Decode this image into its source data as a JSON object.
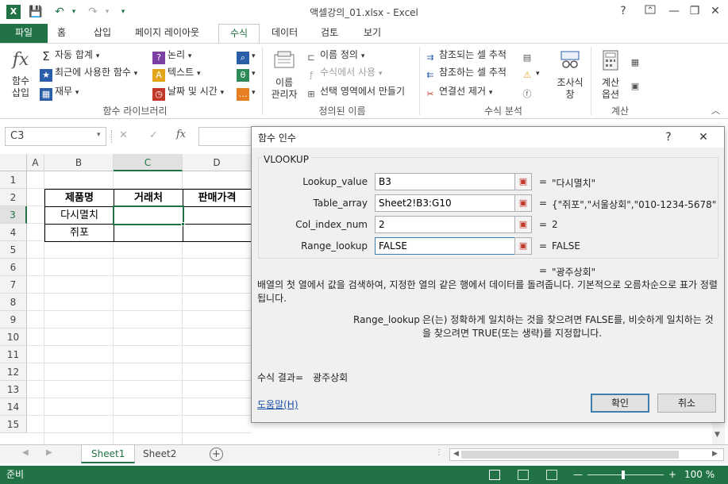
{
  "window": {
    "title": "액셀강의_01.xlsx - Excel",
    "help": "?",
    "minimize": "—",
    "restore": "❐",
    "close": "✕"
  },
  "qat": {
    "logo": "X",
    "save_icon": "💾",
    "undo_icon": "↶",
    "redo_icon": "↷",
    "more_icon": "▾"
  },
  "tabs": [
    {
      "label": "파일"
    },
    {
      "label": "홈"
    },
    {
      "label": "삽입"
    },
    {
      "label": "페이지 레이아웃"
    },
    {
      "label": "수식"
    },
    {
      "label": "데이터"
    },
    {
      "label": "검토"
    },
    {
      "label": "보기"
    }
  ],
  "ribbon": {
    "insert_function": "함수\n삽입",
    "insert_function_l1": "함수",
    "insert_function_l2": "삽입",
    "autosum": "자동 합계",
    "recent": "최근에 사용한 함수",
    "financial": "재무",
    "logical": "논리",
    "text": "텍스트",
    "datetime": "날짜 및 시간",
    "library_label": "함수 라이브러리",
    "name_manager_l1": "이름",
    "name_manager_l2": "관리자",
    "define_name": "이름 정의",
    "use_in_formula": "수식에서 사용",
    "create_from_selection": "선택 영역에서 만들기",
    "defined_names_label": "정의된 이름",
    "trace_precedents": "참조되는 셀 추적",
    "trace_dependents": "참조하는 셀 추적",
    "remove_arrows": "연결선 제거",
    "formula_auditing_label": "수식 분석",
    "watch_l1": "조사식",
    "watch_l2": "창",
    "calc_options_l1": "계산",
    "calc_options_l2": "옵션",
    "calculation_label": "계산"
  },
  "formula_bar": {
    "name_box": "C3",
    "cancel": "✕",
    "enter": "✓",
    "fx": "fx"
  },
  "grid": {
    "columns": [
      "A",
      "B",
      "C",
      "D"
    ],
    "rows": [
      "1",
      "2",
      "3",
      "4",
      "5",
      "6",
      "7",
      "8",
      "9",
      "10",
      "11",
      "12",
      "13",
      "14",
      "15"
    ],
    "selected_col": "C",
    "selected_row": "3",
    "headers": [
      "제품명",
      "거래처",
      "판매가격"
    ],
    "products": [
      "다시멸치",
      "쥐포"
    ]
  },
  "sheets": [
    {
      "label": "Sheet1"
    },
    {
      "label": "Sheet2"
    }
  ],
  "status": {
    "ready": "준비",
    "zoom": "100 %"
  },
  "dialog": {
    "title": "함수 인수",
    "help": "?",
    "close": "✕",
    "function_name": "VLOOKUP",
    "args": [
      {
        "label": "Lookup_value",
        "input": "B3",
        "value": "\"다시멸치\""
      },
      {
        "label": "Table_array",
        "input": "Sheet2!B3:G10",
        "value": "{\"쥐포\",\"서울상회\",\"010-1234-5678\""
      },
      {
        "label": "Col_index_num",
        "input": "2",
        "value": "2"
      },
      {
        "label": "Range_lookup",
        "input": "FALSE",
        "value": "FALSE"
      }
    ],
    "equals": "=",
    "result_preview": "\"광주상회\"",
    "description": "배열의 첫 열에서 값을 검색하여, 지정한 열의 같은 행에서 데이터를 돌려줍니다. 기본적으로 오름차순으로 표가 정렬됩니다.",
    "arg_help_name": "Range_lookup",
    "arg_help_text": "은(는) 정확하게 일치하는 것을 찾으려면 FALSE를, 비슷하게 일치하는 것을 찾으려면 TRUE(또는 생략)를 지정합니다.",
    "formula_result_label": "수식 결과=",
    "formula_result_value": "광주상회",
    "help_link": "도움말(H)",
    "ok": "확인",
    "cancel": "취소"
  }
}
